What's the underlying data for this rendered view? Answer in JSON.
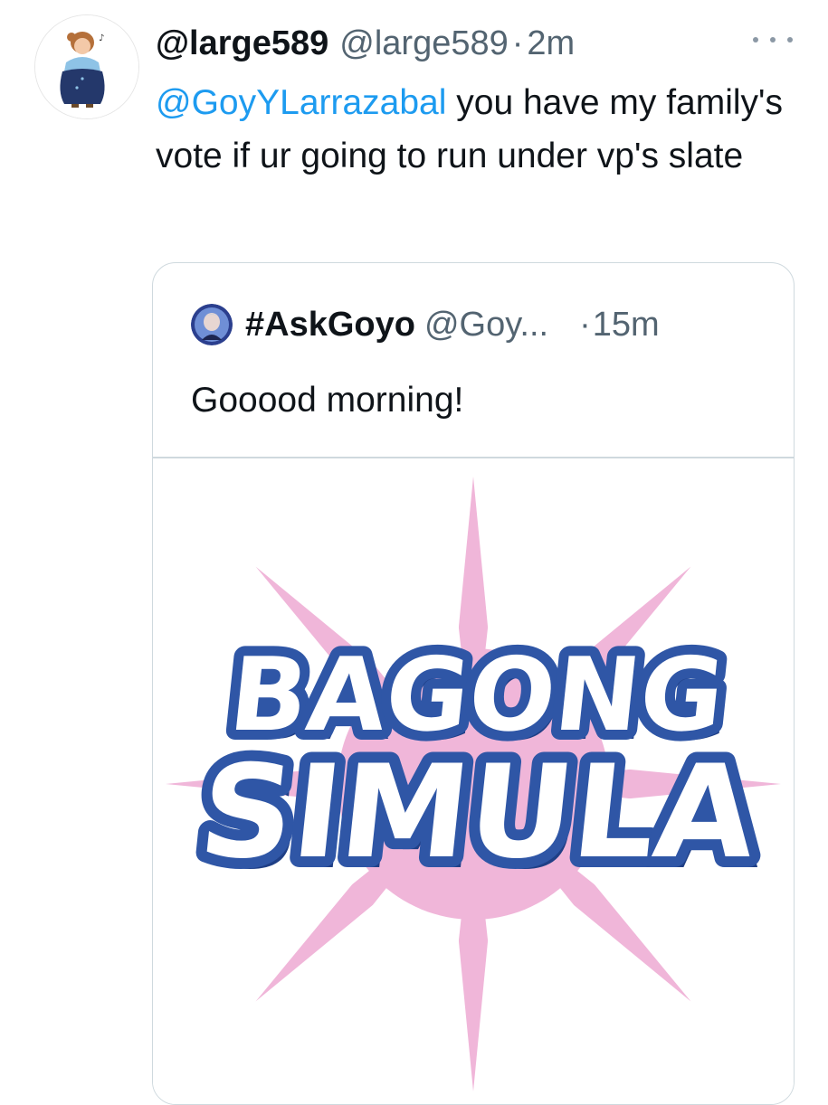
{
  "tweet": {
    "display_name": "@large589",
    "handle": "@large589",
    "separator": "·",
    "time": "2m",
    "mention": "@GoyYLarrazabal",
    "text": " you have my family's vote if ur going to run under vp's slate",
    "more_icon": "more-horizontal-icon"
  },
  "quoted_tweet": {
    "display_name": "#AskGoyo",
    "handle": "@Goy...",
    "separator": "·",
    "time": "15m",
    "text": "Gooood morning!",
    "image": {
      "line1": "BAGONG",
      "line2": "SIMULA",
      "sun_color": "#f0b6d9",
      "outline_color": "#2f56a6",
      "shadow_color": "#1f3f86",
      "fill_color": "#ffffff"
    }
  },
  "colors": {
    "text": "#0f1419",
    "secondary": "#536471",
    "link": "#1d9bf0",
    "border": "#cfd9de"
  }
}
